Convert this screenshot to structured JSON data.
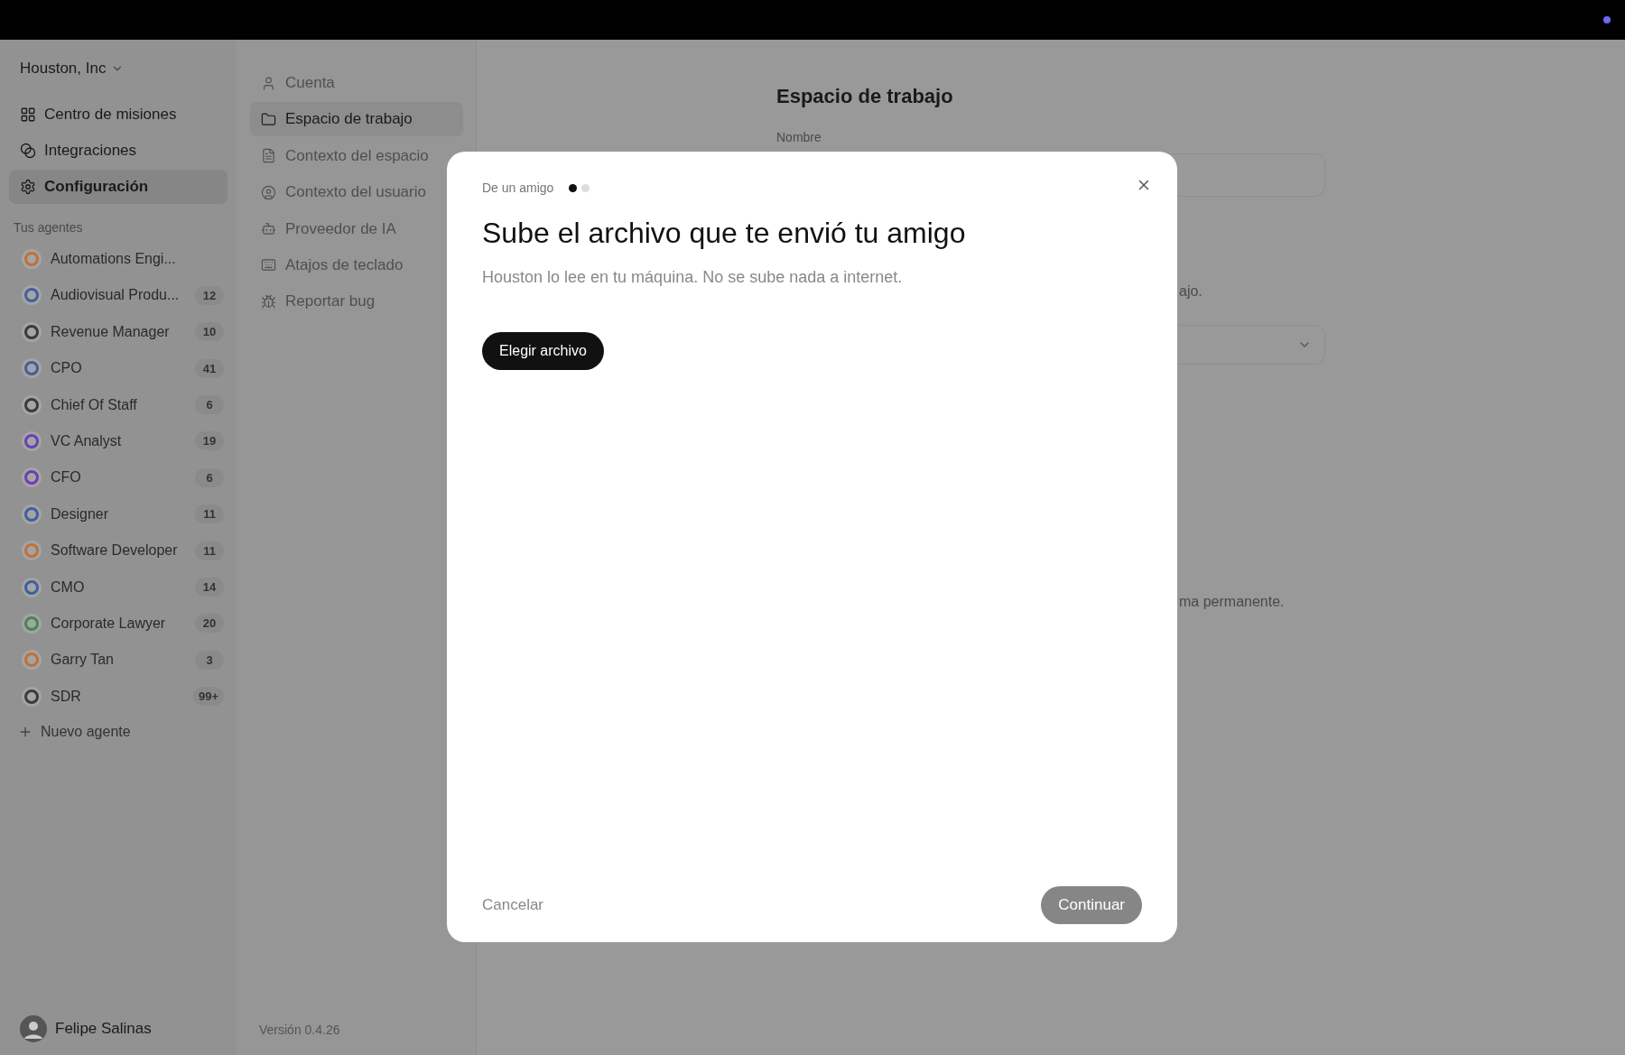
{
  "workspace": {
    "name": "Houston, Inc"
  },
  "nav": [
    {
      "label": "Centro de misiones",
      "selected": false
    },
    {
      "label": "Integraciones",
      "selected": false
    },
    {
      "label": "Configuración",
      "selected": true
    }
  ],
  "agents_heading": "Tus agentes",
  "agents": [
    {
      "name": "Automations Engi...",
      "color": "#c0703a"
    },
    {
      "name": "Audiovisual Produ...",
      "count": "12",
      "color": "#3f5f9e"
    },
    {
      "name": "Revenue Manager",
      "count": "10",
      "color": "#3a3a3a"
    },
    {
      "name": "CPO",
      "count": "41",
      "color": "#3f5f9e"
    },
    {
      "name": "Chief Of Staff",
      "count": "6",
      "color": "#3a3a3a"
    },
    {
      "name": "VC Analyst",
      "count": "19",
      "color": "#6a3fb5"
    },
    {
      "name": "CFO",
      "count": "6",
      "color": "#6a3fb5"
    },
    {
      "name": "Designer",
      "count": "11",
      "color": "#3f5f9e"
    },
    {
      "name": "Software Developer",
      "count": "11",
      "color": "#c0703a"
    },
    {
      "name": "CMO",
      "count": "14",
      "color": "#3f5f9e"
    },
    {
      "name": "Corporate Lawyer",
      "count": "20",
      "color": "#3f8a4f"
    },
    {
      "name": "Garry Tan",
      "count": "3",
      "color": "#c0703a"
    },
    {
      "name": "SDR",
      "count": "99+",
      "color": "#3a3a3a"
    }
  ],
  "new_agent": "Nuevo agente",
  "user": {
    "name": "Felipe Salinas"
  },
  "settings_nav": [
    {
      "label": "Cuenta",
      "selected": false
    },
    {
      "label": "Espacio de trabajo",
      "selected": true
    },
    {
      "label": "Contexto del espacio",
      "selected": false
    },
    {
      "label": "Contexto del usuario",
      "selected": false
    },
    {
      "label": "Proveedor de IA",
      "selected": false
    },
    {
      "label": "Atajos de teclado",
      "selected": false
    },
    {
      "label": "Reportar bug",
      "selected": false
    }
  ],
  "version": "Versión 0.4.26",
  "page": {
    "title": "Espacio de trabajo",
    "name_label": "Nombre",
    "note_1": "ajo.",
    "note_2": "ma permanente."
  },
  "modal": {
    "eyebrow": "De un amigo",
    "steps": [
      {
        "selected": true
      },
      {
        "selected": false
      }
    ],
    "title": "Sube el archivo que te envió tu amigo",
    "subtitle": "Houston lo lee en tu máquina. No se sube nada a internet.",
    "choose_button": "Elegir archivo",
    "cancel": "Cancelar",
    "continue": {
      "label": "Continuar",
      "disabled": true
    }
  }
}
